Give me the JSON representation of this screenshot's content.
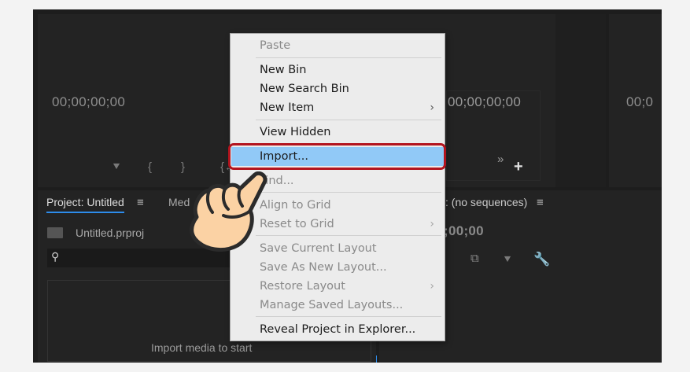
{
  "source_monitor": {
    "timecode": "00;00;00;00"
  },
  "program_monitor": {
    "timecode_left": "00;00;00;00",
    "timecode_right": "00;0"
  },
  "project_panel": {
    "tab_label": "Project: Untitled",
    "tab2_label": "Med",
    "filename": "Untitled.prproj",
    "search_placeholder": "",
    "empty_text": "Import media to start"
  },
  "timeline_panel": {
    "tab_label": ": (no sequences)",
    "timecode": ";00;00"
  },
  "context_menu": {
    "items": [
      {
        "label": "Paste",
        "enabled": false
      },
      {
        "label": "New Bin",
        "enabled": true
      },
      {
        "label": "New Search Bin",
        "enabled": true
      },
      {
        "label": "New Item",
        "enabled": true,
        "submenu": true
      },
      {
        "label": "View Hidden",
        "enabled": true
      },
      {
        "label": "Import...",
        "enabled": true,
        "highlighted": true
      },
      {
        "label": "Find...",
        "enabled": false
      },
      {
        "label": "Align to Grid",
        "enabled": false
      },
      {
        "label": "Reset to Grid",
        "enabled": false,
        "submenu": true
      },
      {
        "label": "Save Current Layout",
        "enabled": false
      },
      {
        "label": "Save As New Layout...",
        "enabled": false
      },
      {
        "label": "Restore Layout",
        "enabled": false,
        "submenu": true
      },
      {
        "label": "Manage Saved Layouts...",
        "enabled": false
      },
      {
        "label": "Reveal Project in Explorer...",
        "enabled": true
      }
    ]
  },
  "colors": {
    "highlight": "#91c9f7",
    "ring": "#b3141e",
    "accent_tab": "#2d8ceb"
  },
  "icons": {
    "submenu": "chevron-right-icon",
    "folder": "folder-icon",
    "search": "search-icon",
    "wrench": "wrench-icon",
    "marker": "marker-icon",
    "hand": "pointing-hand-icon"
  }
}
